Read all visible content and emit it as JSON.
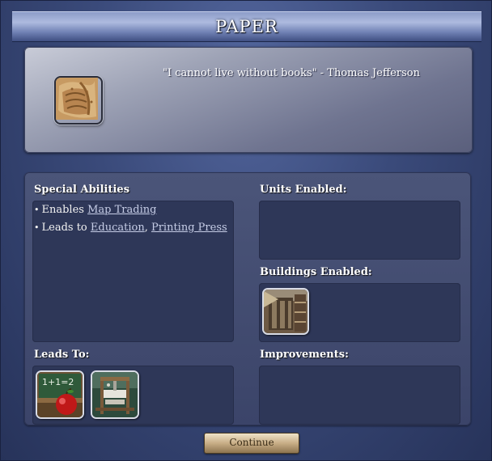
{
  "title": "PAPER",
  "quote": "\"I cannot live without books\" - Thomas Jefferson",
  "icons": {
    "advance": "paper-scroll-icon",
    "building": "library-building-icon",
    "leads_to": [
      "education-icon",
      "printing-press-icon"
    ]
  },
  "special_abilities": {
    "label": "Special Abilities",
    "lines": [
      {
        "bullet": "•",
        "prefix": "Enables ",
        "links": [
          "Map Trading"
        ]
      },
      {
        "bullet": "•",
        "prefix": "Leads to ",
        "links": [
          "Education",
          "Printing Press"
        ],
        "separator": ","
      }
    ]
  },
  "units_enabled": {
    "label": "Units Enabled:"
  },
  "buildings_enabled": {
    "label": "Buildings Enabled:"
  },
  "leads_to": {
    "label": "Leads To:"
  },
  "improvements": {
    "label": "Improvements:"
  },
  "continue_label": "Continue",
  "colors": {
    "background": "#3a4a7a",
    "panel": "#3b4469",
    "box": "#2e3758",
    "link": "#c6cde6",
    "button": "#c8ae86"
  }
}
